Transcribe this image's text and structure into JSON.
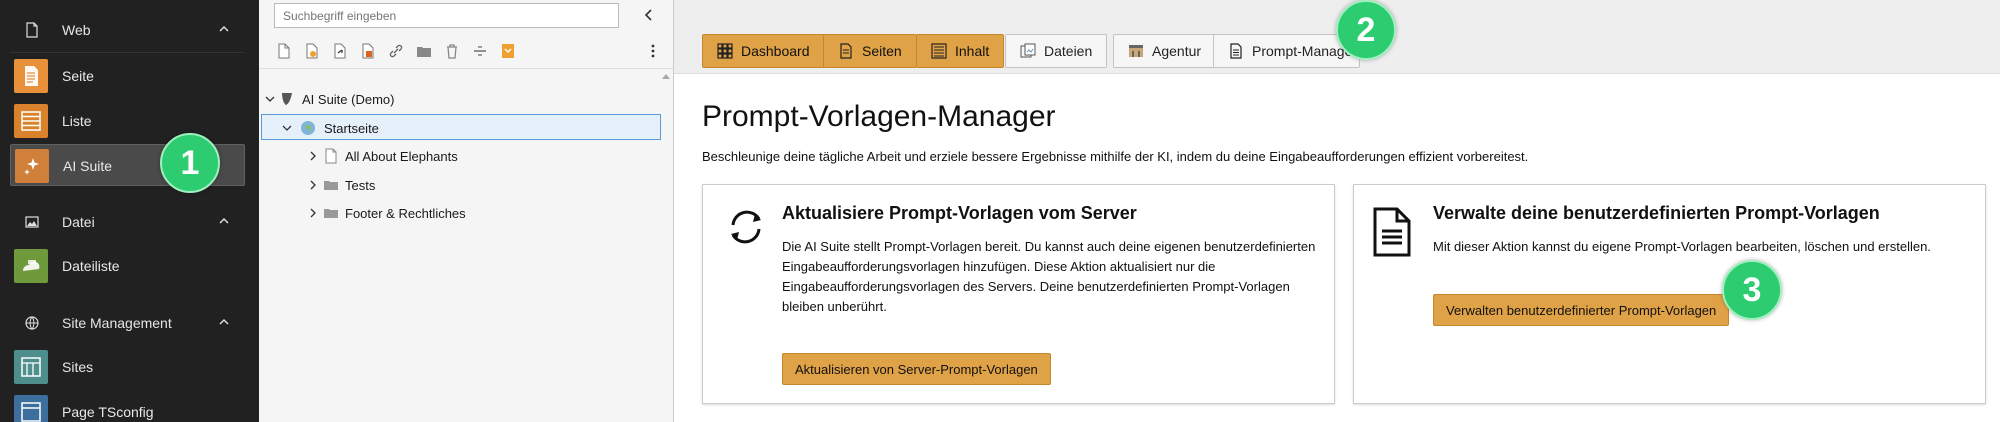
{
  "module_menu": {
    "groups": [
      {
        "label": "Web",
        "icon": "page-icon"
      },
      {
        "label": "Datei",
        "icon": "image-icon"
      },
      {
        "label": "Site Management",
        "icon": "globe-icon"
      }
    ],
    "items": [
      {
        "label": "Seite",
        "icon": "page-module-icon",
        "color": "#e8913a"
      },
      {
        "label": "Liste",
        "icon": "list-module-icon",
        "color": "#d9822b"
      },
      {
        "label": "AI Suite",
        "icon": "sparkle-module-icon",
        "color": "#d0803a",
        "active": true
      },
      {
        "label": "Dateiliste",
        "icon": "filelist-module-icon",
        "color": "#6e9a3b"
      },
      {
        "label": "Sites",
        "icon": "sites-module-icon",
        "color": "#4e8f8d"
      },
      {
        "label": "Page TSconfig",
        "icon": "tsconfig-module-icon",
        "color": "#3c6e9e"
      }
    ]
  },
  "page_tree": {
    "search_placeholder": "Suchbegriff eingeben",
    "toolbar_icons": [
      "new-page-icon",
      "page-icon-2",
      "page-link-icon",
      "page-shortcut-icon",
      "link-icon",
      "folder-icon",
      "trash-icon",
      "divider-icon",
      "backend-layout-icon",
      "more-icon"
    ],
    "root": "AI Suite (Demo)",
    "selected": "Startseite",
    "children": [
      "All About Elephants",
      "Tests",
      "Footer & Rechtliches"
    ]
  },
  "header_buttons": [
    {
      "label": "Dashboard",
      "icon": "grid-icon",
      "style": "primary"
    },
    {
      "label": "Seiten",
      "icon": "pages-icon",
      "style": "primary"
    },
    {
      "label": "Inhalt",
      "icon": "content-icon",
      "style": "primary"
    },
    {
      "label": "Dateien",
      "icon": "files-icon",
      "style": "default"
    },
    {
      "label": "Agentur",
      "icon": "agency-icon",
      "style": "default"
    },
    {
      "label": "Prompt-Manager",
      "icon": "document-icon",
      "style": "default"
    }
  ],
  "main": {
    "title": "Prompt-Vorlagen-Manager",
    "description": "Beschleunige deine tägliche Arbeit und erziele bessere Ergebnisse mithilfe der KI, indem du deine Eingabeaufforderungen effizient vorbereitest.",
    "cards": [
      {
        "icon": "refresh-icon",
        "title": "Aktualisiere Prompt-Vorlagen vom Server",
        "text": "Die AI Suite stellt Prompt-Vorlagen bereit. Du kannst auch deine eigenen benutzerdefinierten Eingabeaufforderungsvorlagen hinzufügen. Diese Aktion aktualisiert nur die Eingabeaufforderungsvorlagen des Servers. Deine benutzerdefinierten Prompt-Vorlagen bleiben unberührt.",
        "button": "Aktualisieren von Server-Prompt-Vorlagen"
      },
      {
        "icon": "document-large-icon",
        "title": "Verwalte deine benutzerdefinierten Prompt-Vorlagen",
        "text": "Mit dieser Aktion kannst du eigene Prompt-Vorlagen bearbeiten, löschen und erstellen.",
        "button": "Verwalten benutzerdefinierter Prompt-Vorlagen"
      }
    ]
  },
  "markers": [
    "1",
    "2",
    "3"
  ],
  "colors": {
    "accent": "#e0a246",
    "marker": "#2ecc71",
    "menu_bg": "#212121"
  }
}
